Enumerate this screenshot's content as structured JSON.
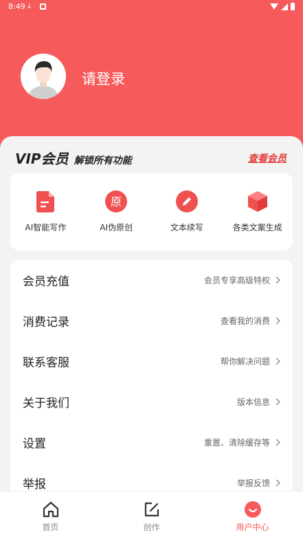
{
  "status_bar": {
    "time": "8:49"
  },
  "header": {
    "login_label": "请登录"
  },
  "vip": {
    "title": "VIP会员",
    "subtitle": "解锁所有功能",
    "link": "查看会员"
  },
  "features": [
    {
      "label": "AI智能写作",
      "icon": "document-icon"
    },
    {
      "label": "AI伪原创",
      "icon": "original-icon",
      "glyph": "原"
    },
    {
      "label": "文本续写",
      "icon": "pencil-icon"
    },
    {
      "label": "各类文案生成",
      "icon": "cube-icon"
    }
  ],
  "menu": [
    {
      "label": "会员充值",
      "detail": "会员专享高级特权"
    },
    {
      "label": "消费记录",
      "detail": "查看我的消费"
    },
    {
      "label": "联系客服",
      "detail": "帮你解决问题"
    },
    {
      "label": "关于我们",
      "detail": "版本信息"
    },
    {
      "label": "设置",
      "detail": "重置、清除缓存等"
    },
    {
      "label": "举报",
      "detail": "举报反馈"
    }
  ],
  "tabs": [
    {
      "label": "首页",
      "icon": "home-icon"
    },
    {
      "label": "创作",
      "icon": "edit-icon"
    },
    {
      "label": "用户中心",
      "icon": "user-center-icon"
    }
  ],
  "colors": {
    "accent": "#f65a5a",
    "background": "#f3f3f3"
  }
}
